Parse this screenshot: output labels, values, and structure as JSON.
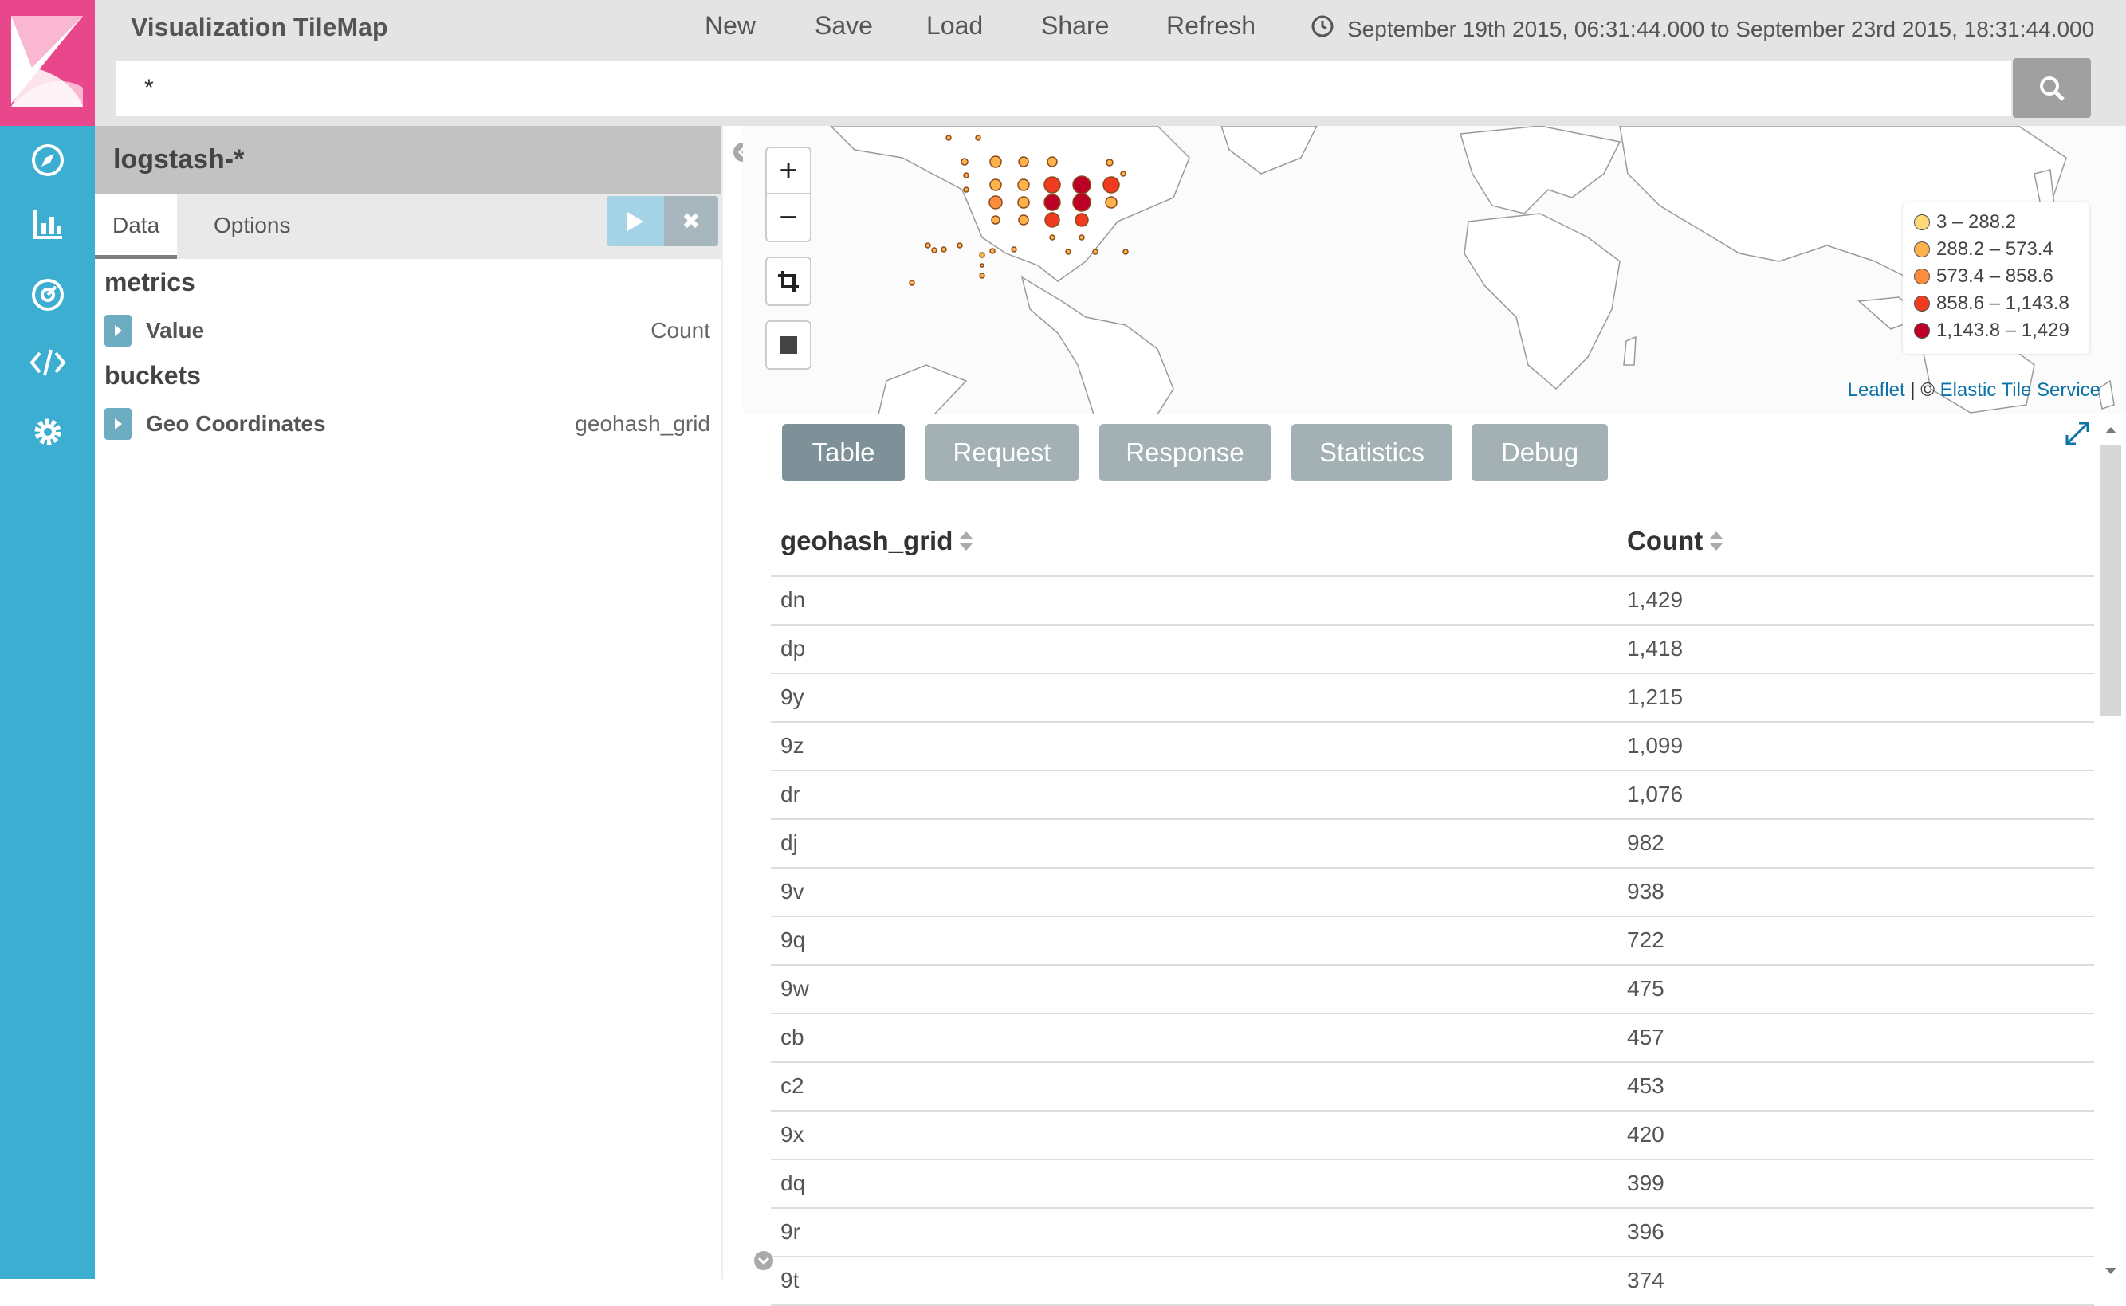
{
  "app": {
    "title": "Visualization TileMap"
  },
  "topbar": {
    "buttons": [
      "New",
      "Save",
      "Load",
      "Share",
      "Refresh"
    ],
    "time_range": "September 19th 2015, 06:31:44.000 to September 23rd 2015, 18:31:44.000"
  },
  "query": {
    "value": "*"
  },
  "nav": {
    "icons": [
      "kibana-logo",
      "discover-icon",
      "visualize-icon",
      "dashboard-icon",
      "dev-tools-icon",
      "settings-icon"
    ],
    "bg_color": "#3caed2",
    "logo_color": "#e8488b"
  },
  "sidebar": {
    "index_pattern": "logstash-*",
    "tabs": [
      "Data",
      "Options"
    ],
    "metrics_title": "metrics",
    "metric": {
      "name": "Value",
      "value": "Count"
    },
    "buckets_title": "buckets",
    "bucket": {
      "name": "Geo Coordinates",
      "value": "geohash_grid"
    }
  },
  "map": {
    "legend": [
      {
        "label": "3 – 288.2",
        "color": "#fed976"
      },
      {
        "label": "288.2 – 573.4",
        "color": "#feb24c"
      },
      {
        "label": "573.4 – 858.6",
        "color": "#fd8d3c"
      },
      {
        "label": "858.6 – 1,143.8",
        "color": "#f03b20"
      },
      {
        "label": "1,143.8 – 1,429",
        "color": "#bd0026"
      }
    ],
    "attribution_leaflet": "Leaflet",
    "attribution_sep": " | © ",
    "attribution_service": "Elastic Tile Service"
  },
  "spy": {
    "tabs": [
      "Table",
      "Request",
      "Response",
      "Statistics",
      "Debug"
    ],
    "active_tab": "Table"
  },
  "table": {
    "headers": [
      "geohash_grid",
      "Count"
    ],
    "rows": [
      [
        "dn",
        "1,429"
      ],
      [
        "dp",
        "1,418"
      ],
      [
        "9y",
        "1,215"
      ],
      [
        "9z",
        "1,099"
      ],
      [
        "dr",
        "1,076"
      ],
      [
        "dj",
        "982"
      ],
      [
        "9v",
        "938"
      ],
      [
        "9q",
        "722"
      ],
      [
        "9w",
        "475"
      ],
      [
        "cb",
        "457"
      ],
      [
        "c2",
        "453"
      ],
      [
        "9x",
        "420"
      ],
      [
        "dq",
        "399"
      ],
      [
        "9r",
        "396"
      ],
      [
        "9t",
        "374"
      ]
    ]
  }
}
